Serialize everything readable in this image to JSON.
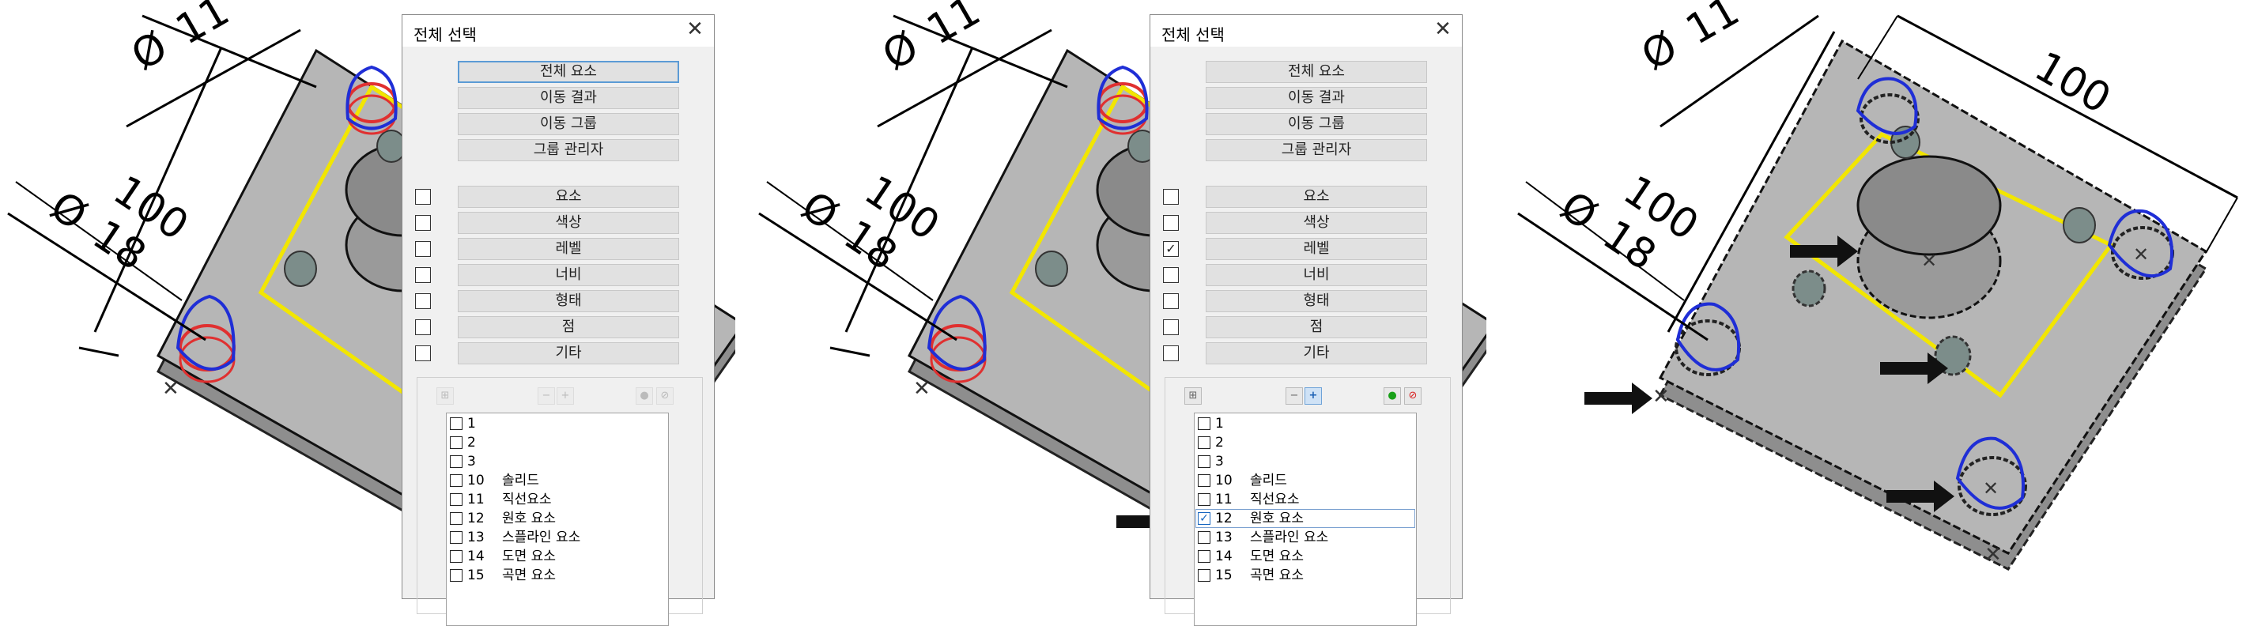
{
  "dialog": {
    "title": "전체 선택",
    "close_icon": "close-icon",
    "top_buttons": [
      "전체 요소",
      "이동 결과",
      "이동 그룹",
      "그룹 관리자"
    ],
    "filters": [
      {
        "label": "요소",
        "checked": false
      },
      {
        "label": "색상",
        "checked": false
      },
      {
        "label": "레벨",
        "checked": false
      },
      {
        "label": "너비",
        "checked": false
      },
      {
        "label": "형태",
        "checked": false
      },
      {
        "label": "점",
        "checked": false
      },
      {
        "label": "기타",
        "checked": false
      }
    ],
    "toolbar_icons": [
      "grid-icon",
      "minus-icon",
      "plus-icon",
      "all-on-icon",
      "none-icon"
    ],
    "levels": [
      {
        "num": "1",
        "name": ""
      },
      {
        "num": "2",
        "name": ""
      },
      {
        "num": "3",
        "name": ""
      },
      {
        "num": "10",
        "name": "솔리드"
      },
      {
        "num": "11",
        "name": "직선요소"
      },
      {
        "num": "12",
        "name": "원호 요소"
      },
      {
        "num": "13",
        "name": "스플라인 요소"
      },
      {
        "num": "14",
        "name": "도면 요소"
      },
      {
        "num": "15",
        "name": "곡면 요소"
      }
    ]
  },
  "step2": {
    "checked_filter": "레벨",
    "checked_level": "12"
  },
  "cad": {
    "dimensions": {
      "dia_small": "11",
      "dia_large": "18",
      "width": "100",
      "depth": "100"
    },
    "diameter_symbol": "Ø",
    "colors": {
      "plate": "#b6b6b6",
      "plate_edge": "#8e8e8e",
      "yellow": "#f2e600",
      "blue": "#1f2ed6",
      "red": "#e03030",
      "arrow": "#111111"
    }
  }
}
